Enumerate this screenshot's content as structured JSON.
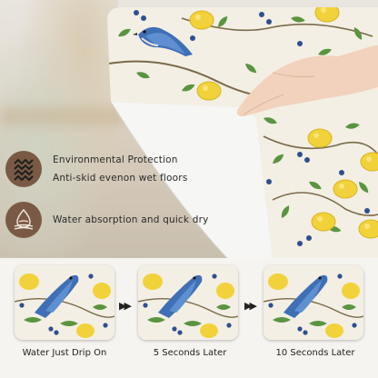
{
  "features": [
    {
      "icon": "antiskid-grip-icon",
      "lines": [
        "Environmental Protection",
        "Anti-skid evenon wet floors"
      ]
    },
    {
      "icon": "water-drop-icon",
      "lines": [
        "Water absorption and quick dry"
      ]
    }
  ],
  "comparison": {
    "arrow": "▶▶",
    "steps": [
      {
        "caption": "Water Just Drip On"
      },
      {
        "caption": "5 Seconds Later"
      },
      {
        "caption": "10 Seconds Later"
      }
    ]
  },
  "colors": {
    "icon_bg": "#7a5a45",
    "mat_bg": "#f3efe4",
    "lemon": "#f2d23a",
    "bird": "#3f6fb5",
    "leaf": "#4f8a3a",
    "berry": "#2f4f8f"
  }
}
